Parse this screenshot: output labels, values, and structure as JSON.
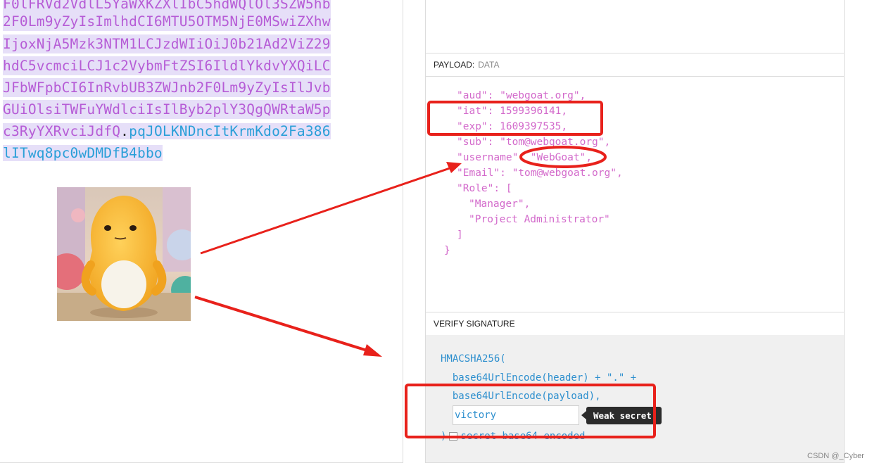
{
  "encoded": {
    "lines": [
      {
        "text": "F0lFRVd2VdlL5YaWXKZXlIbC5hdWQlOl3SZW5hb",
        "parts": "payload"
      },
      {
        "text": "2F0Lm9yZyIsImlhdCI6MTU5OTM5NjE0MSwiZXhw",
        "parts": "payload"
      },
      {
        "text": "IjoxNjA5Mzk3NTM1LCJzdWIiOiJ0b21Ad2ViZ29",
        "parts": "payload"
      },
      {
        "text": "hdC5vcmciLCJ1c2VybmFtZSI6IldlYkdvYXQiLC",
        "parts": "payload"
      },
      {
        "text": "JFbWFpbCI6InRvbUB3ZWJnb2F0Lm9yZyIsIlJvb",
        "parts": "payload"
      },
      {
        "text": "GUiOlsiTWFuYWdlciIsIlByb2plY3QgQWRtaW5p",
        "parts": "payload"
      }
    ],
    "line7_payload": "c3RyYXRvciJdfQ",
    "line7_dot": ".",
    "line7_sig": "pqJOLKNDncItKrmKdo2Fa386",
    "line8_sig": "lITwq8pc0wDMDfB4bbo"
  },
  "payload_section": {
    "title": "PAYLOAD:",
    "subtitle": "DATA",
    "json_lines": [
      "\"aud\": \"webgoat.org\",",
      "\"iat\": 1599396141,",
      "\"exp\": 1609397535,",
      "\"sub\": \"tom@webgoat.org\",",
      "\"username\": \"WebGoat\",",
      "\"Email\": \"tom@webgoat.org\",",
      "\"Role\": [",
      "\"Manager\",",
      "\"Project Administrator\"",
      "]",
      "}"
    ]
  },
  "verify_section": {
    "title": "VERIFY SIGNATURE",
    "code_line1": "HMACSHA256(",
    "code_line2": "  base64UrlEncode(header) + \".\" +",
    "code_line3": "  base64UrlEncode(payload),",
    "secret_value": "victory",
    "tooltip": "Weak secret!",
    "close_paren": ")",
    "b64_label": "secret base64 encoded"
  },
  "watermark": "CSDN @_Cyber",
  "colors": {
    "annotation_red": "#e8211b",
    "payload_text": "#d36acb",
    "code_blue": "#2d8fce"
  }
}
